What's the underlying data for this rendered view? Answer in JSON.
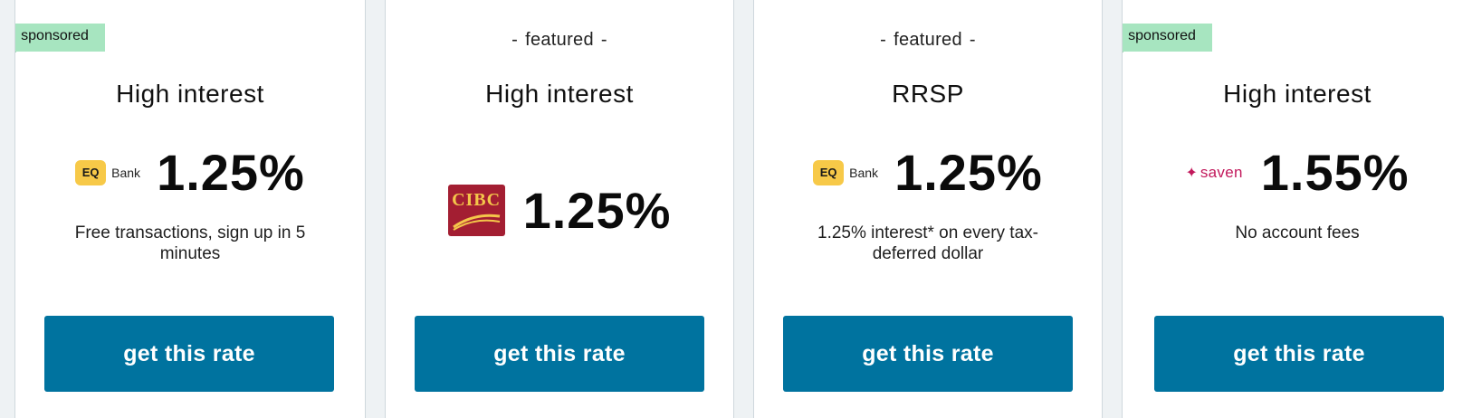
{
  "cards": [
    {
      "badge": "sponsored",
      "title": "High interest",
      "logo": {
        "name": "eq-bank-logo",
        "box": "EQ",
        "text": "Bank"
      },
      "rate": "1.25%",
      "description": "Free transactions, sign up in 5 minutes",
      "cta": "get this rate"
    },
    {
      "featured": "featured",
      "title": "High interest",
      "logo": {
        "name": "cibc-logo",
        "text": "CIBC"
      },
      "rate": "1.25%",
      "cta": "get this rate"
    },
    {
      "featured": "featured",
      "title": "RRSP",
      "logo": {
        "name": "eq-bank-logo",
        "box": "EQ",
        "text": "Bank"
      },
      "rate": "1.25%",
      "description": "1.25% interest* on every tax-deferred dollar",
      "cta": "get this rate"
    },
    {
      "badge": "sponsored",
      "title": "High interest",
      "logo": {
        "name": "saven-logo",
        "text": "saven"
      },
      "rate": "1.55%",
      "description": "No account fees",
      "cta": "get this rate"
    }
  ],
  "colors": {
    "button": "#00739f",
    "sponsored_tag": "#a7e5c0",
    "cibc_red": "#a31e32",
    "eq_yellow": "#f7c948",
    "saven_pink": "#c2185b"
  },
  "featured_dash": "-"
}
